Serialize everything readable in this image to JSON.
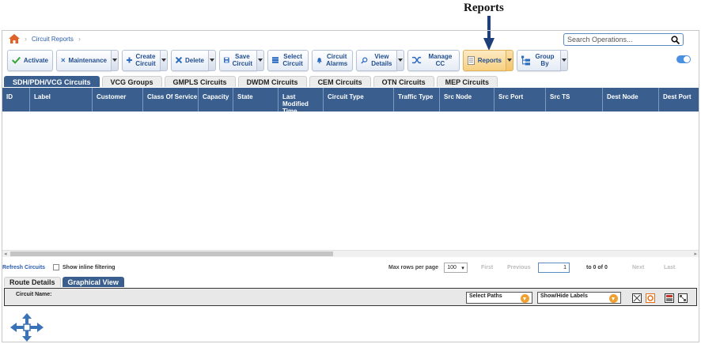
{
  "callout": {
    "label": "Reports"
  },
  "breadcrumb": {
    "items": [
      "Circuit Reports"
    ]
  },
  "search": {
    "placeholder": "Search Operations..."
  },
  "toolbar": {
    "activate": "Activate",
    "maintenance": "Maintenance",
    "create_circuit": "Create Circuit",
    "delete": "Delete",
    "save_circuit": "Save Circuit",
    "select_circuit": "Select Circuit",
    "circuit_alarms": "Circuit Alarms",
    "view_details": "View Details",
    "manage_cc": "Manage CC",
    "reports": "Reports",
    "group_by": "Group By"
  },
  "tabs": [
    "SDH/PDH/VCG Circuits",
    "VCG Groups",
    "GMPLS Circuits",
    "DWDM Circuits",
    "CEM Circuits",
    "OTN Circuits",
    "MEP Circuits"
  ],
  "active_tab": "SDH/PDH/VCG Circuits",
  "columns": [
    "ID",
    "Label",
    "Customer",
    "Class Of Service",
    "Capacity",
    "State",
    "Last Modified Time",
    "Circuit Type",
    "Traffic Type",
    "Src Node",
    "Src Port",
    "Src TS",
    "Dest Node",
    "Dest Port"
  ],
  "pager": {
    "refresh": "Refresh Circuits",
    "inline_filter": "Show inline filtering",
    "max_rows_label": "Max rows per page",
    "max_rows_value": "100",
    "first": "First",
    "previous": "Previous",
    "page": "1",
    "range": "to 0 of 0",
    "next": "Next",
    "last": "Last"
  },
  "bottom_tabs": [
    "Route Details",
    "Graphical View"
  ],
  "bottom_active": "Graphical View",
  "graphical": {
    "circuit_name_label": "Circuit Name:",
    "select_paths": "Select Paths",
    "show_hide_labels": "Show/Hide Labels"
  },
  "colors": {
    "header_blue": "#3a5f8f",
    "accent_orange": "#f0a030",
    "link_blue": "#2a5db0",
    "home_icon": "#e0622a"
  }
}
